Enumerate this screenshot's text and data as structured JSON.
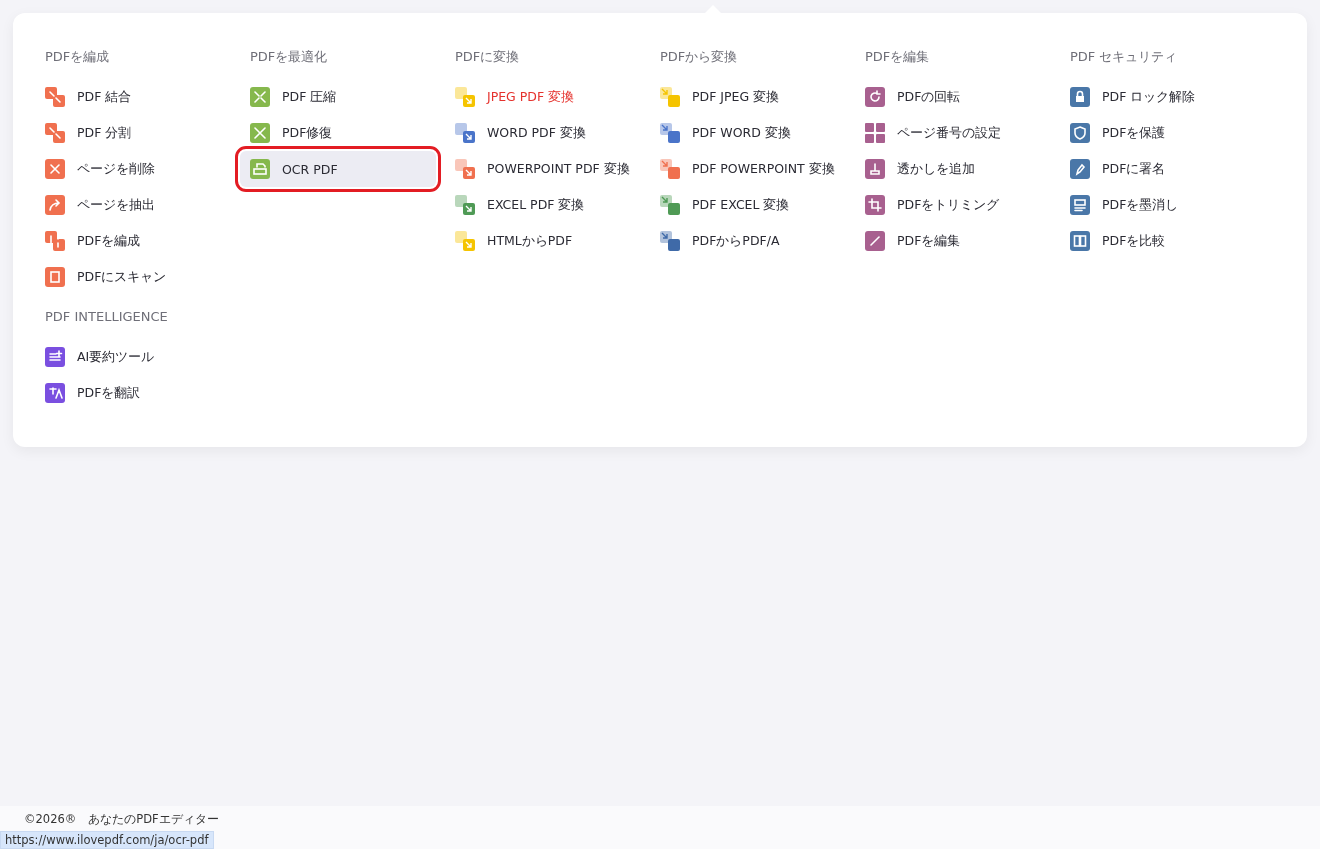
{
  "menu": {
    "sections": [
      {
        "title": "PDFを編成",
        "color": "#f0704f",
        "items": [
          {
            "label": "PDF 結合",
            "kind": "merge",
            "hovered": false,
            "current": false,
            "outlined": false
          },
          {
            "label": "PDF 分割",
            "kind": "split",
            "hovered": false,
            "current": false,
            "outlined": false
          },
          {
            "label": "ページを削除",
            "kind": "delete",
            "hovered": false,
            "current": false,
            "outlined": false
          },
          {
            "label": "ページを抽出",
            "kind": "extract",
            "hovered": false,
            "current": false,
            "outlined": false
          },
          {
            "label": "PDFを編成",
            "kind": "organize",
            "hovered": false,
            "current": false,
            "outlined": false
          },
          {
            "label": "PDFにスキャン",
            "kind": "scan",
            "hovered": false,
            "current": false,
            "outlined": false
          }
        ]
      },
      {
        "title": "PDF INTELLIGENCE",
        "color": "#7a4fe0",
        "items": [
          {
            "label": "AI要約ツール",
            "kind": "summary",
            "hovered": false,
            "current": false,
            "outlined": false
          },
          {
            "label": "PDFを翻訳",
            "kind": "translate",
            "hovered": false,
            "current": false,
            "outlined": false
          }
        ]
      },
      {
        "title": "PDFを最適化",
        "color": "#86b84d",
        "items": [
          {
            "label": "PDF 圧縮",
            "kind": "compress",
            "hovered": false,
            "current": false,
            "outlined": false
          },
          {
            "label": "PDF修復",
            "kind": "repair",
            "hovered": false,
            "current": false,
            "outlined": false
          },
          {
            "label": "OCR PDF",
            "kind": "ocr",
            "hovered": true,
            "current": false,
            "outlined": true
          }
        ]
      },
      {
        "title": "PDFに変換",
        "items": [
          {
            "label": "JPEG PDF 変換",
            "kind": "to",
            "color": "#f5c400",
            "hovered": false,
            "current": true,
            "outlined": false
          },
          {
            "label": "WORD PDF 変換",
            "kind": "to",
            "color": "#4a74c9",
            "hovered": false,
            "current": false,
            "outlined": false
          },
          {
            "label": "POWERPOINT PDF 変換",
            "kind": "to",
            "color": "#f0704f",
            "hovered": false,
            "current": false,
            "outlined": false
          },
          {
            "label": "EXCEL PDF 変換",
            "kind": "to",
            "color": "#4f9a55",
            "hovered": false,
            "current": false,
            "outlined": false
          },
          {
            "label": "HTMLからPDF",
            "kind": "to",
            "color": "#f5c400",
            "hovered": false,
            "current": false,
            "outlined": false
          }
        ]
      },
      {
        "title": "PDFから変換",
        "items": [
          {
            "label": "PDF JPEG 変換",
            "kind": "from",
            "color": "#f5c400",
            "hovered": false,
            "current": false,
            "outlined": false
          },
          {
            "label": "PDF WORD 変換",
            "kind": "from",
            "color": "#4a74c9",
            "hovered": false,
            "current": false,
            "outlined": false
          },
          {
            "label": "PDF POWERPOINT 変換",
            "kind": "from",
            "color": "#f0704f",
            "hovered": false,
            "current": false,
            "outlined": false
          },
          {
            "label": "PDF EXCEL 変換",
            "kind": "from",
            "color": "#4f9a55",
            "hovered": false,
            "current": false,
            "outlined": false
          },
          {
            "label": "PDFからPDF/A",
            "kind": "from",
            "color": "#3f6aa8",
            "hovered": false,
            "current": false,
            "outlined": false
          }
        ]
      },
      {
        "title": "PDFを編集",
        "color": "#a8608f",
        "items": [
          {
            "label": "PDFの回転",
            "kind": "rotate",
            "hovered": false,
            "current": false,
            "outlined": false
          },
          {
            "label": "ページ番号の設定",
            "kind": "numbers",
            "hovered": false,
            "current": false,
            "outlined": false
          },
          {
            "label": "透かしを追加",
            "kind": "stamp",
            "hovered": false,
            "current": false,
            "outlined": false
          },
          {
            "label": "PDFをトリミング",
            "kind": "crop",
            "hovered": false,
            "current": false,
            "outlined": false
          },
          {
            "label": "PDFを編集",
            "kind": "pencil",
            "hovered": false,
            "current": false,
            "outlined": false
          }
        ]
      },
      {
        "title": "PDF セキュリティ",
        "color": "#4a77a8",
        "items": [
          {
            "label": "PDF ロック解除",
            "kind": "lock",
            "hovered": false,
            "current": false,
            "outlined": false
          },
          {
            "label": "PDFを保護",
            "kind": "shield",
            "hovered": false,
            "current": false,
            "outlined": false
          },
          {
            "label": "PDFに署名",
            "kind": "pen",
            "hovered": false,
            "current": false,
            "outlined": false
          },
          {
            "label": "PDFを墨消し",
            "kind": "redact",
            "hovered": false,
            "current": false,
            "outlined": false
          },
          {
            "label": "PDFを比較",
            "kind": "compare",
            "hovered": false,
            "current": false,
            "outlined": false
          }
        ]
      }
    ]
  },
  "footer": {
    "text": "©2026®　あなたのPDFエディター"
  },
  "status_url": "https://www.ilovepdf.com/ja/ocr-pdf"
}
